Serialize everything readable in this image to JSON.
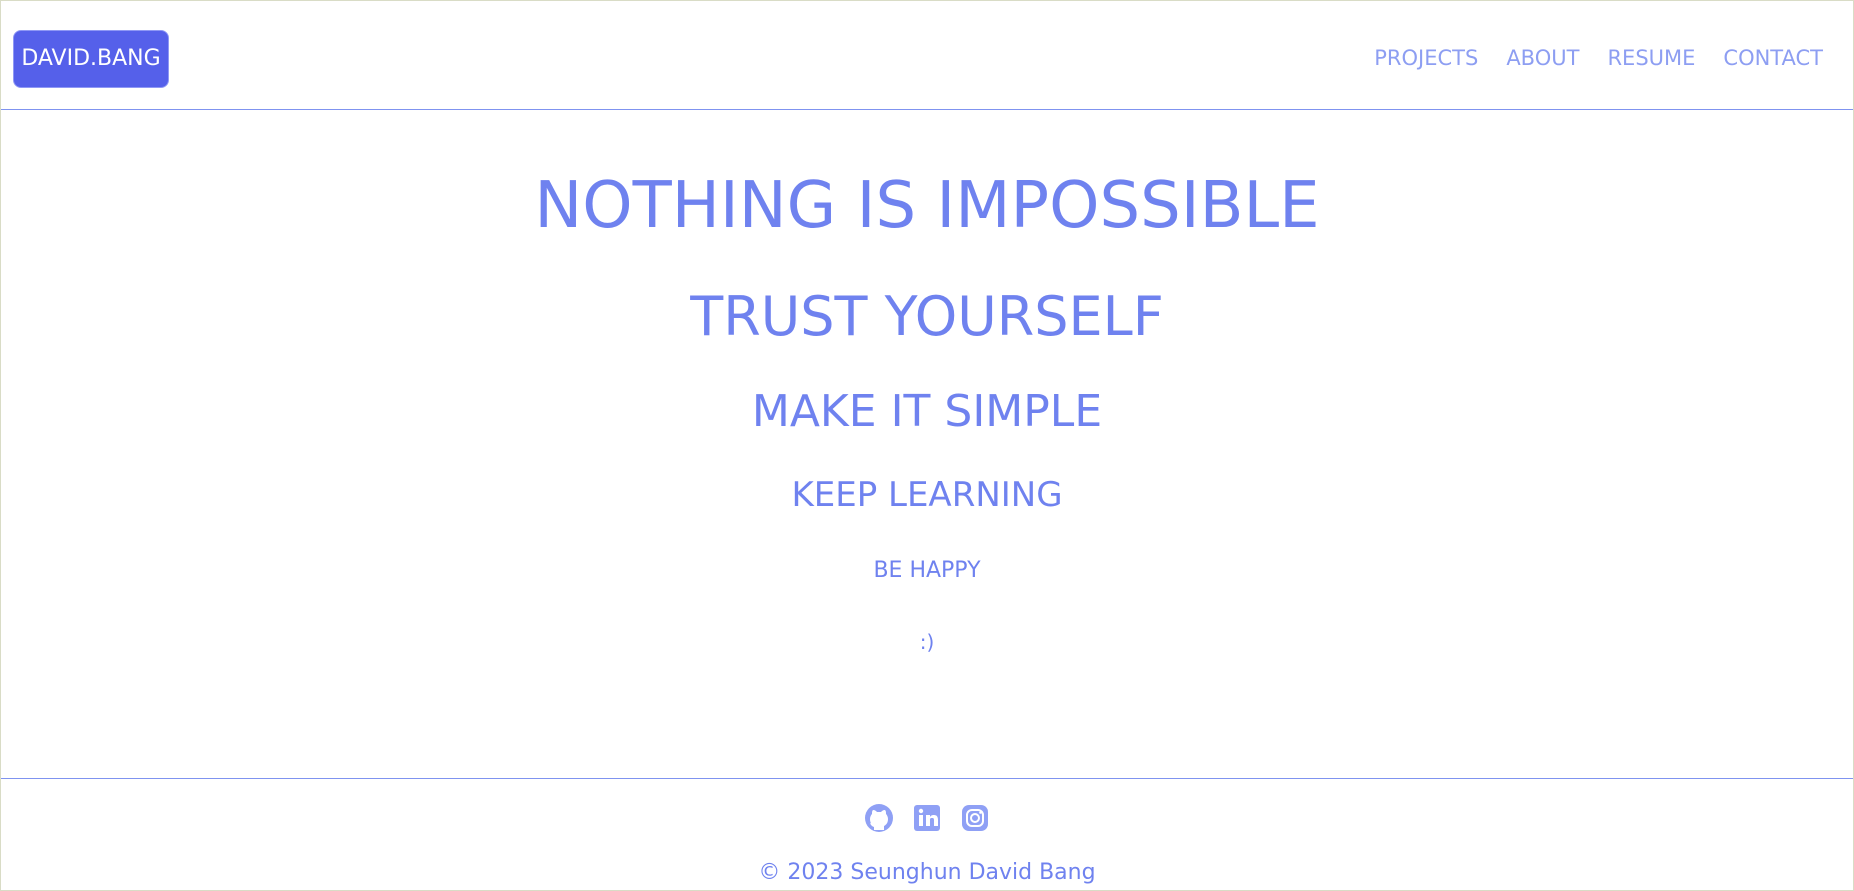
{
  "header": {
    "brand": "DAVID.BANG",
    "nav": [
      "PROJECTS",
      "ABOUT",
      "RESUME",
      "CONTACT"
    ]
  },
  "main": {
    "lines": [
      "NOTHING IS IMPOSSIBLE",
      "TRUST YOURSELF",
      "MAKE IT SIMPLE",
      "KEEP LEARNING",
      "BE HAPPY",
      ":)"
    ]
  },
  "footer": {
    "icons": [
      "github-icon",
      "linkedin-icon",
      "instagram-icon"
    ],
    "copyright": "© 2023 Seunghun David Bang"
  },
  "colors": {
    "brand_bg": "#5560ea",
    "accent": "#6f82ef",
    "nav": "#8d9ef2",
    "divider": "#7f93f0"
  }
}
